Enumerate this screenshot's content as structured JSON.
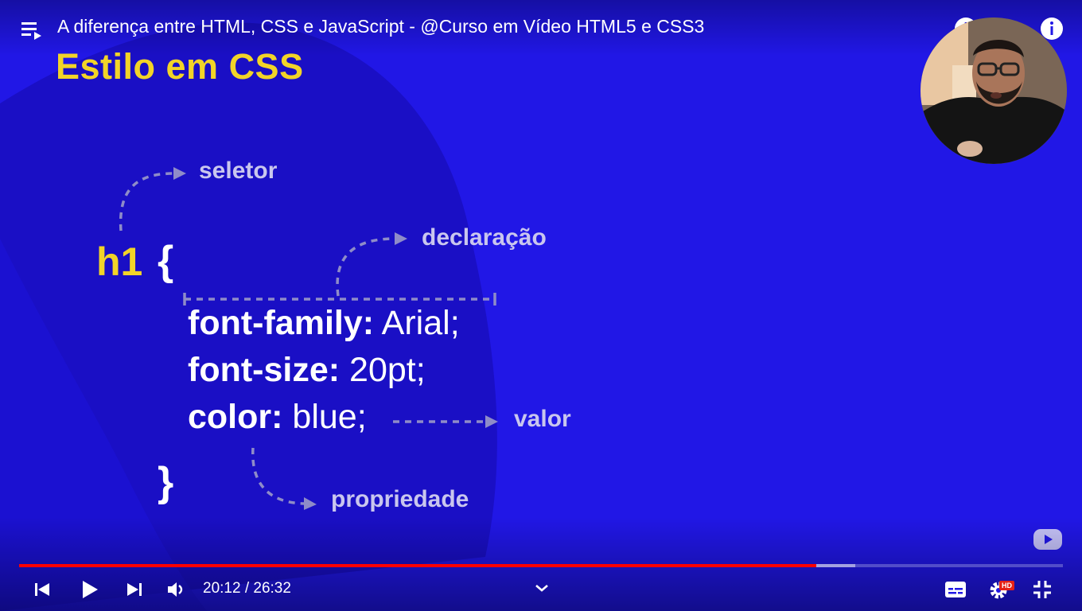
{
  "video": {
    "title": "A diferença entre HTML, CSS e JavaScript - @Curso em Vídeo HTML5 e CSS3"
  },
  "slide": {
    "title": "Estilo em CSS",
    "selector": "h1",
    "open_brace": "{",
    "close_brace": "}",
    "lines": [
      {
        "property": "font-family:",
        "value": " Arial;"
      },
      {
        "property": "font-size:",
        "value": " 20pt;"
      },
      {
        "property": "color:",
        "value": " blue;"
      }
    ],
    "annotations": {
      "selector": "seletor",
      "declaration": "declaração",
      "value": "valor",
      "property": "propriedade"
    }
  },
  "player": {
    "time_display": "20:12 / 26:32",
    "played_fraction": 0.7634,
    "buffered_fraction": 0.801,
    "hd_badge": "HD"
  },
  "colors": {
    "background": "#2117e6",
    "title_yellow": "#f2d428",
    "progress_red": "#ff0000"
  }
}
